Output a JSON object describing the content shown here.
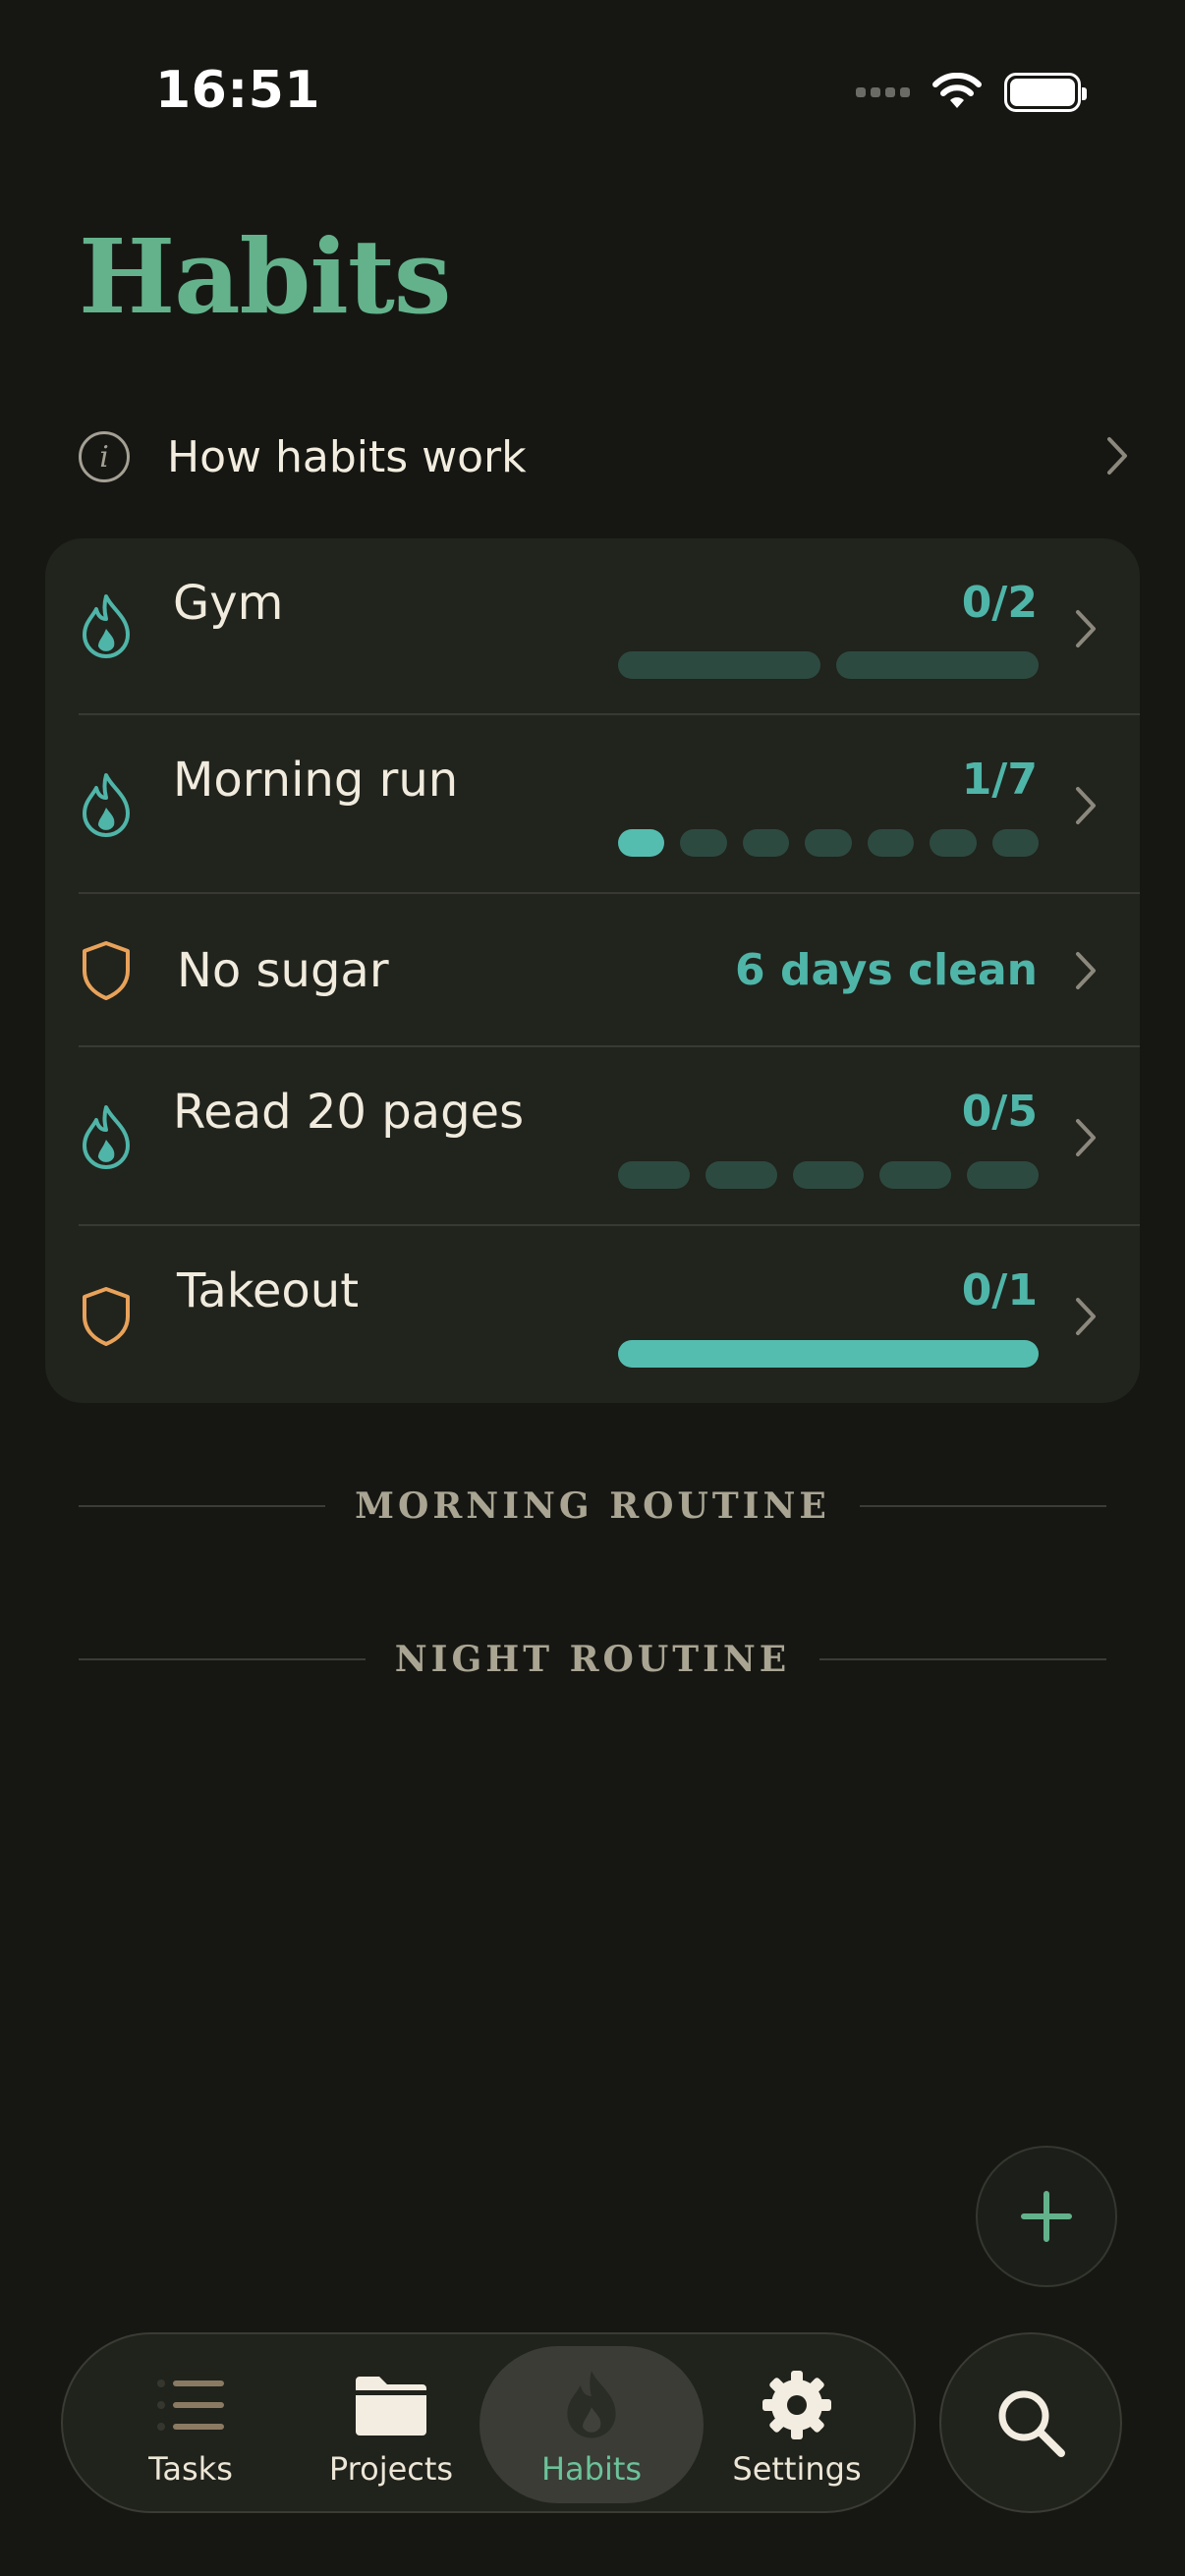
{
  "status_bar": {
    "time": "16:51"
  },
  "page": {
    "title": "Habits"
  },
  "info_row": {
    "label": "How habits work"
  },
  "habits": [
    {
      "name": "Gym",
      "type": "streak",
      "count_text": "0/2",
      "done": 0,
      "total": 2
    },
    {
      "name": "Morning run",
      "type": "streak",
      "count_text": "1/7",
      "done": 1,
      "total": 7
    },
    {
      "name": "No sugar",
      "type": "avoid",
      "count_text": "6 days clean"
    },
    {
      "name": "Read 20 pages",
      "type": "streak",
      "count_text": "0/5",
      "done": 0,
      "total": 5
    },
    {
      "name": "Takeout",
      "type": "avoid",
      "count_text": "0/1",
      "done": 1,
      "total": 1
    }
  ],
  "sections": [
    {
      "label": "MORNING ROUTINE"
    },
    {
      "label": "NIGHT ROUTINE"
    }
  ],
  "tab_bar": {
    "tabs": [
      {
        "label": "Tasks",
        "icon": "list-icon"
      },
      {
        "label": "Projects",
        "icon": "folder-icon"
      },
      {
        "label": "Habits",
        "icon": "flame-icon",
        "active": true
      },
      {
        "label": "Settings",
        "icon": "gear-icon"
      }
    ]
  },
  "colors": {
    "accent_green": "#63b28b",
    "accent_teal": "#55bdb0",
    "segment_empty": "#2d4a41",
    "shield_orange": "#e8a25a",
    "background": "#161713",
    "card": "#21231d"
  }
}
